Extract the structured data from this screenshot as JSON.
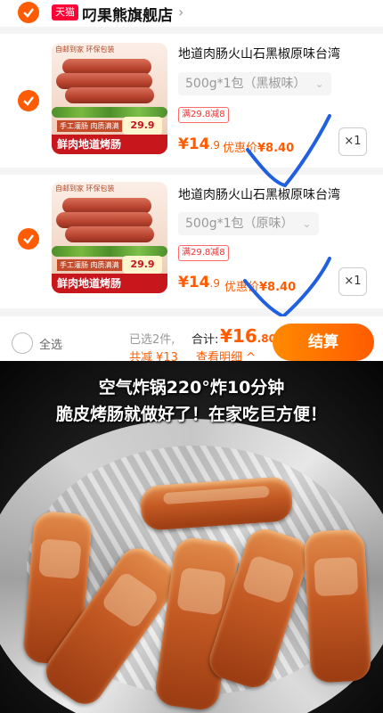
{
  "shop": {
    "badge": "天猫",
    "name": "叼果熊旗舰店",
    "chevron": "›"
  },
  "items": [
    {
      "thumb_tag": "自邮到家 环保包装",
      "thumb_sub": "手工灌肠 肉质满满",
      "thumb_title": "鲜肉地道烤肠",
      "thumb_price": "29.9",
      "name": "地道肉肠火山石黑椒原味台湾",
      "sku": "500g*1包（黑椒味）",
      "promo": "满29.8减8",
      "price_int": "¥14",
      "price_dec": ".9",
      "deal_label": "优惠价",
      "deal_price": "¥8.40",
      "qty": "×1"
    },
    {
      "thumb_tag": "自邮到家 环保包装",
      "thumb_sub": "手工灌肠 肉质满满",
      "thumb_title": "鲜肉地道烤肠",
      "thumb_price": "29.9",
      "name": "地道肉肠火山石黑椒原味台湾",
      "sku": "500g*1包（原味）",
      "promo": "满29.8减8",
      "price_int": "¥14",
      "price_dec": ".9",
      "deal_label": "优惠价",
      "deal_price": "¥8.40",
      "qty": "×1"
    }
  ],
  "footer": {
    "select_all": "全选",
    "selected_count": "已选2件,",
    "total_label": "合计:",
    "total_int": "¥16",
    "total_dec": ".80",
    "discount": "共减 ¥13",
    "detail": "查看明细 ^",
    "checkout": "结算"
  },
  "photo": {
    "caption_line1": "空气炸锅220°炸10分钟",
    "caption_line2": "脆皮烤肠就做好了！在家吃巨方便！"
  },
  "colors": {
    "accent": "#ff5b00",
    "tmall_red": "#ff0036",
    "scribble_blue": "#1f5fe0"
  }
}
